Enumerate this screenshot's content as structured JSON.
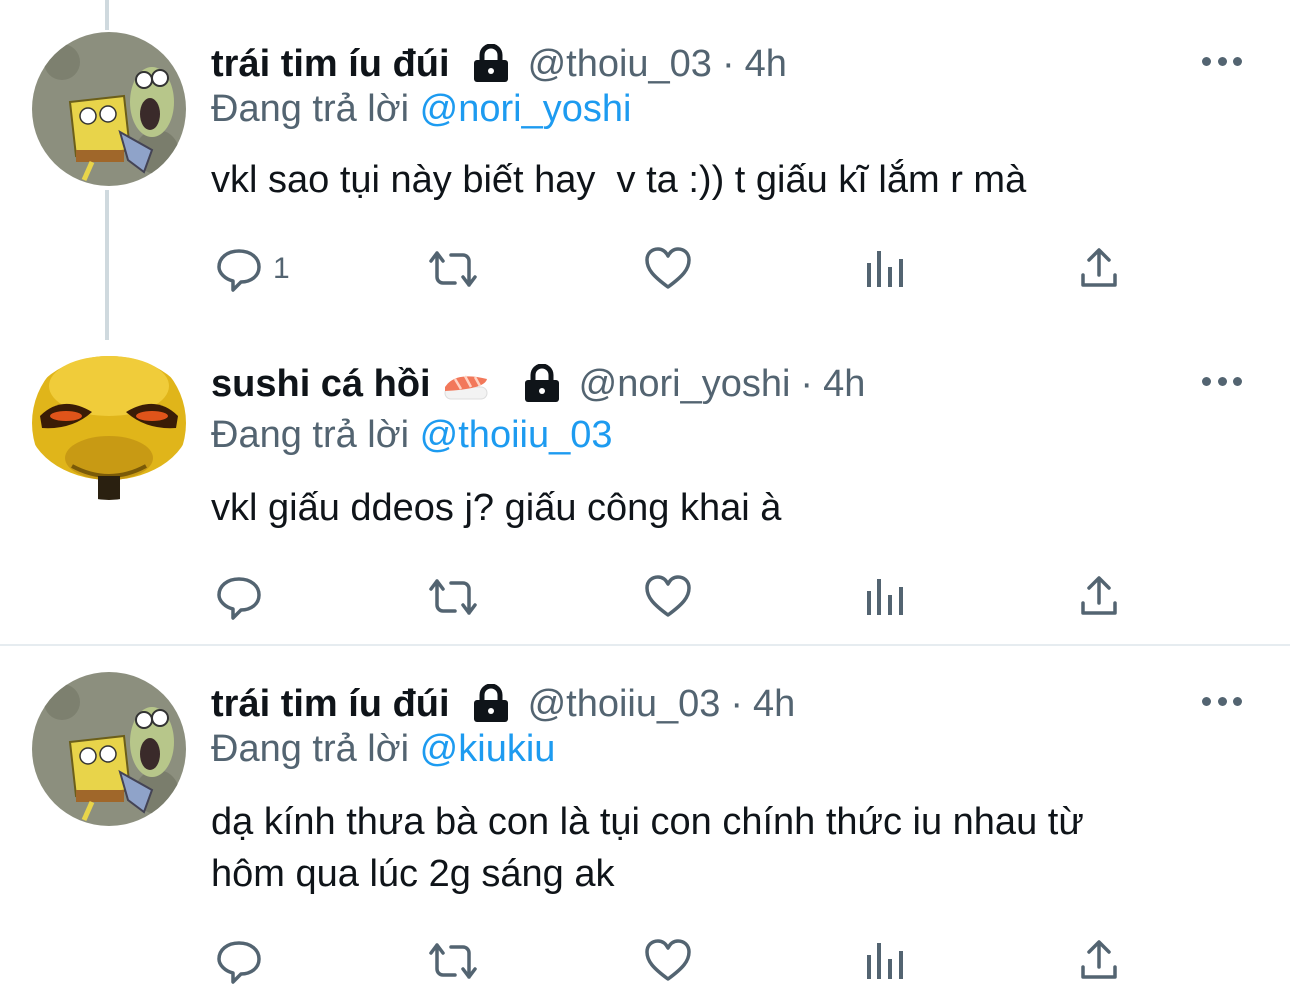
{
  "tweets": [
    {
      "name": "trái tim íu đúi",
      "handle": "@thoiu_03",
      "separator": "·",
      "time": "4h",
      "replying_prefix": "Đang trả lời",
      "replying_to": "@nori_yoshi",
      "text": "vkl sao tụi này biết hay  v ta :)) t giấu kĩ lắm r mà",
      "reply_count": "1",
      "avatar": "spongebob-screaming-avatar",
      "has_emoji": false
    },
    {
      "name": "sushi cá hồi",
      "handle": "@nori_yoshi",
      "separator": "·",
      "time": "4h",
      "replying_prefix": "Đang trả lời",
      "replying_to": "@thoiiu_03",
      "text": "vkl giấu ddeos j? giấu công khai à",
      "reply_count": "",
      "avatar": "yellow-creature-avatar",
      "has_emoji": true,
      "emoji": "sushi-emoji"
    },
    {
      "name": "trái tim íu đúi",
      "handle": "@thoiiu_03",
      "separator": "·",
      "time": "4h",
      "replying_prefix": "Đang trả lời",
      "replying_to": "@kiukiu",
      "text": "dạ kính thưa bà con là tụi con chính thức iu nhau từ\nhôm qua lúc 2g sáng ak",
      "reply_count": "",
      "avatar": "spongebob-screaming-avatar",
      "has_emoji": false
    }
  ],
  "icons": {
    "reply": "speech-bubble-icon",
    "retweet": "retweet-icon",
    "like": "heart-icon",
    "analytics": "bar-chart-icon",
    "share": "share-icon",
    "more": "more-dots-icon",
    "protected": "lock-icon"
  },
  "colors": {
    "text": "#0f1419",
    "secondary": "#536471",
    "accent": "#1d9bf0",
    "divider": "#e6ecf0"
  }
}
